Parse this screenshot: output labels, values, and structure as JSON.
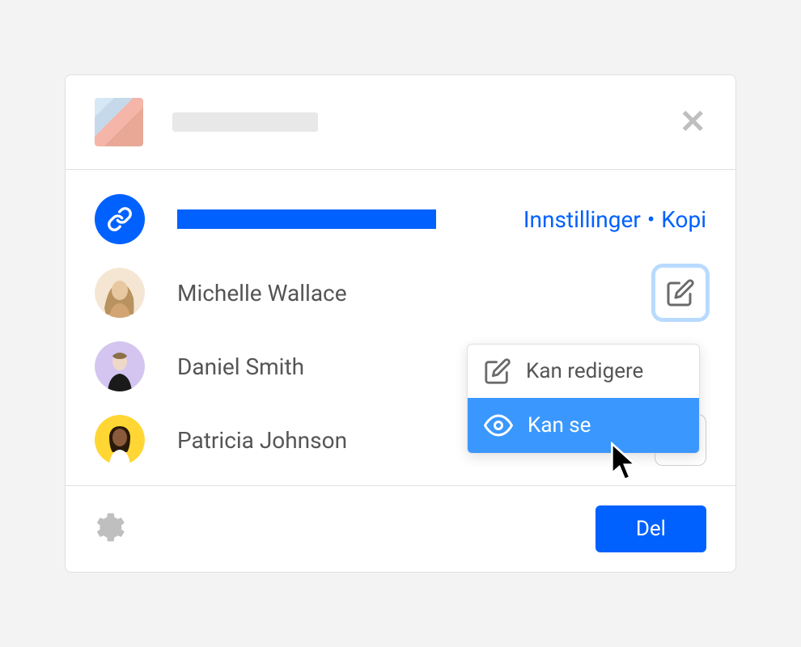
{
  "link_row": {
    "settings_label": "Innstillinger",
    "copy_label": "Kopi"
  },
  "users": [
    {
      "name": "Michelle Wallace",
      "permission": "edit"
    },
    {
      "name": "Daniel Smith",
      "permission": "view"
    },
    {
      "name": "Patricia Johnson",
      "permission": "view"
    }
  ],
  "permission_menu": {
    "edit_label": "Kan redigere",
    "view_label": "Kan se"
  },
  "footer": {
    "share_label": "Del"
  },
  "colors": {
    "primary": "#0061fe",
    "accent_light": "#3a97fe"
  }
}
